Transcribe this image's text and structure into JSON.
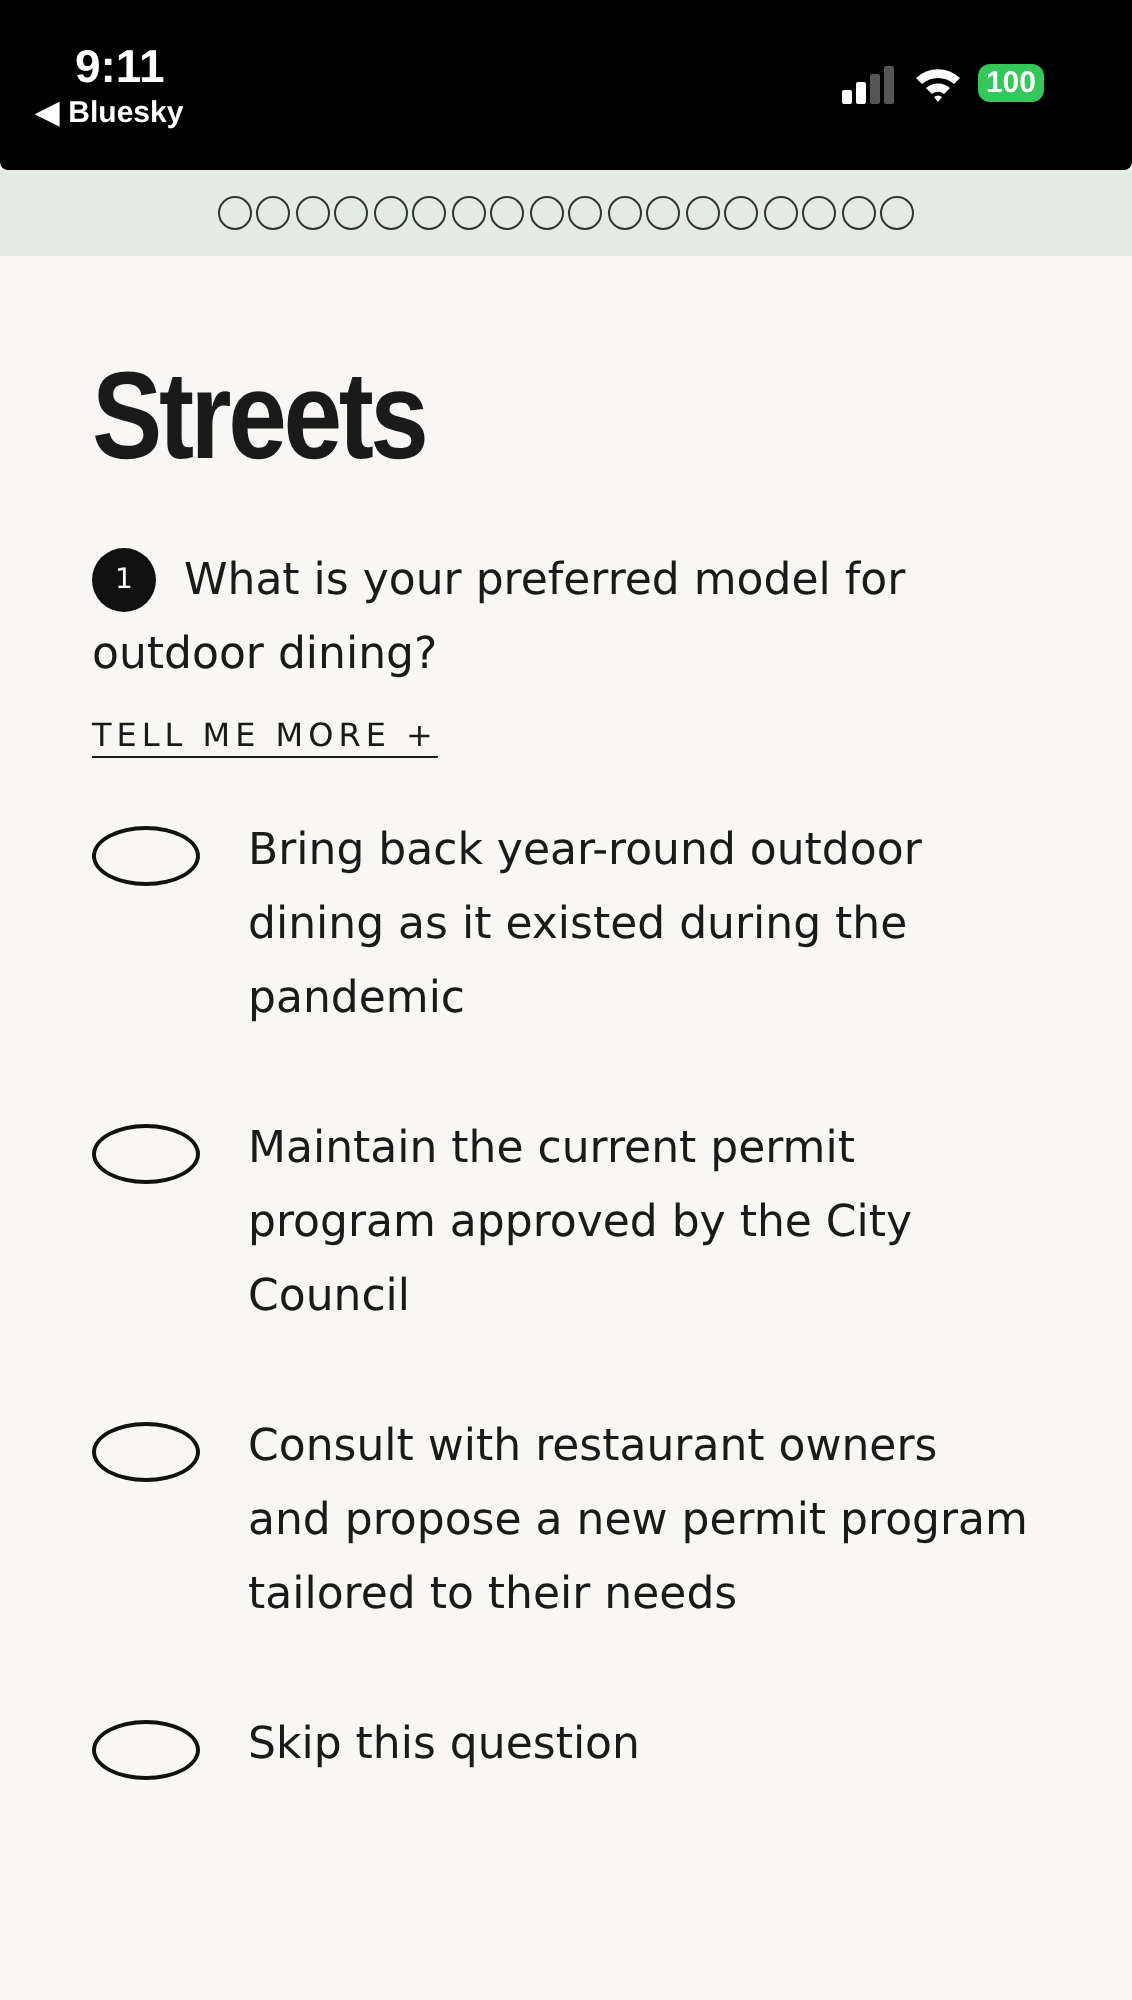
{
  "status_bar": {
    "time": "9:11",
    "back_label": "◀ Bluesky",
    "battery": "100"
  },
  "progress": [
    {
      "filled": false
    },
    {
      "filled": false
    },
    {
      "filled": false
    },
    {
      "filled": false
    },
    {
      "filled": false
    },
    {
      "filled": false
    },
    {
      "filled": false
    },
    {
      "filled": false
    },
    {
      "filled": false
    },
    {
      "filled": false
    },
    {
      "filled": false
    },
    {
      "filled": false
    },
    {
      "filled": false
    },
    {
      "filled": false
    },
    {
      "filled": false
    },
    {
      "filled": false
    },
    {
      "filled": false
    },
    {
      "filled": false
    }
  ],
  "title": "Streets",
  "question": {
    "number": "1",
    "text": "What is your preferred model for outdoor dining?"
  },
  "more_link": "TELL ME MORE +",
  "options": [
    {
      "label": "Bring back year-round outdoor dining as it existed during the pandemic",
      "selected": false
    },
    {
      "label": "Maintain the current permit program approved by the City Council",
      "selected": false
    },
    {
      "label": "Consult with restaurant owners and propose a new permit program tailored to their needs",
      "selected": false
    },
    {
      "label": "Skip this question",
      "selected": false
    }
  ]
}
